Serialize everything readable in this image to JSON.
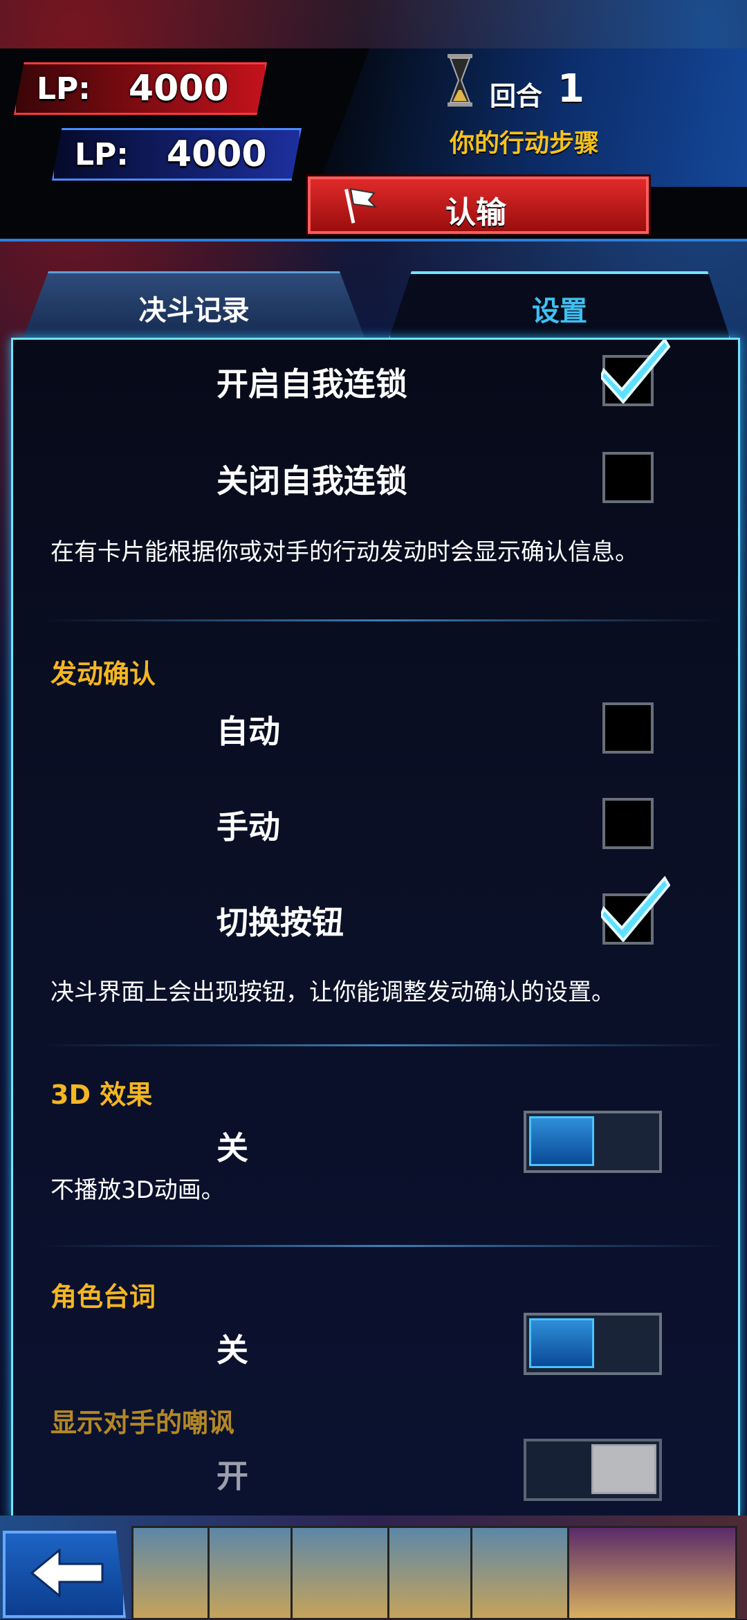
{
  "hud": {
    "player_lp_label": "LP:",
    "player_lp_value": "4000",
    "opponent_lp_label": "LP:",
    "opponent_lp_value": "4000",
    "round_label": "回合",
    "round_number": "1",
    "phase": "你的行动步骤",
    "surrender_label": "认输"
  },
  "tabs": {
    "duel_log": "决斗记录",
    "settings": "设置"
  },
  "settings": {
    "self_chain": {
      "on_label": "开启自我连锁",
      "on_checked": true,
      "off_label": "关闭自我连锁",
      "off_checked": false,
      "description": "在有卡片能根据你或对手的行动发动时会显示确认信息。"
    },
    "activation_confirm": {
      "title": "发动确认",
      "auto_label": "自动",
      "auto_checked": false,
      "manual_label": "手动",
      "manual_checked": false,
      "toggle_button_label": "切换按钮",
      "toggle_button_checked": true,
      "description": "决斗界面上会出现按钮，让你能调整发动确认的设置。"
    },
    "effects_3d": {
      "title": "3D 效果",
      "state_label": "关",
      "enabled": false,
      "description": "不播放3D动画。"
    },
    "character_lines": {
      "title": "角色台词",
      "state_label": "关",
      "enabled": false
    },
    "opponent_taunt": {
      "title": "显示对手的嘲讽",
      "state_label": "开",
      "enabled": true
    }
  },
  "colors": {
    "accent_cyan": "#6fe4ff",
    "section_gold": "#f4b622",
    "phase_gold": "#f6c21c",
    "surrender_red": "#c4121c"
  },
  "icons": {
    "hourglass": "hourglass-icon",
    "flag": "flag-icon",
    "check": "check-icon",
    "back": "back-arrow-icon"
  }
}
